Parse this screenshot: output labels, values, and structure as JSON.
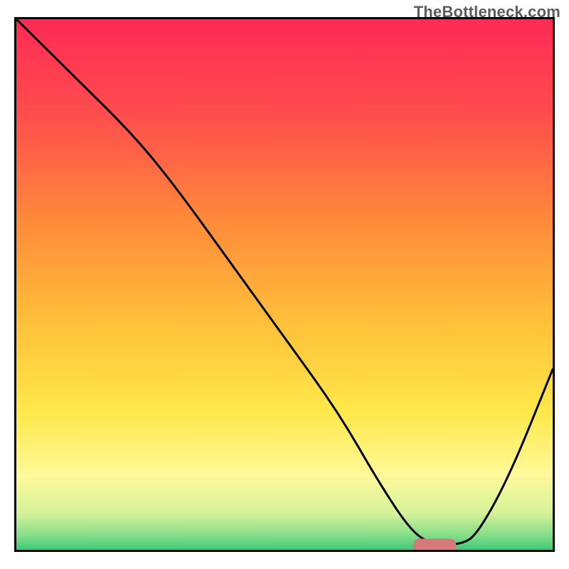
{
  "watermark": "TheBottleneck.com",
  "chart_data": {
    "type": "line",
    "title": "",
    "xlabel": "",
    "ylabel": "",
    "xlim": [
      0,
      100
    ],
    "ylim": [
      0,
      100
    ],
    "x": [
      0,
      10,
      22,
      30,
      40,
      50,
      60,
      68,
      74,
      78,
      83,
      86,
      92,
      100
    ],
    "values": [
      100,
      90,
      78,
      68,
      54,
      40,
      26,
      12,
      3,
      1,
      1,
      3,
      14,
      34
    ],
    "marker": {
      "x_range": [
        74,
        82
      ],
      "y": 0.7,
      "color": "#d47b7a",
      "radius": 1.4
    },
    "gradient_stops": [
      {
        "offset": 0,
        "color": "#ff2a55"
      },
      {
        "offset": 18,
        "color": "#ff4d4d"
      },
      {
        "offset": 38,
        "color": "#ff8a3a"
      },
      {
        "offset": 58,
        "color": "#ffc23a"
      },
      {
        "offset": 74,
        "color": "#ffe84a"
      },
      {
        "offset": 86,
        "color": "#fff99a"
      },
      {
        "offset": 93,
        "color": "#d6f29a"
      },
      {
        "offset": 97,
        "color": "#8be08a"
      },
      {
        "offset": 100,
        "color": "#3fc97a"
      }
    ]
  }
}
